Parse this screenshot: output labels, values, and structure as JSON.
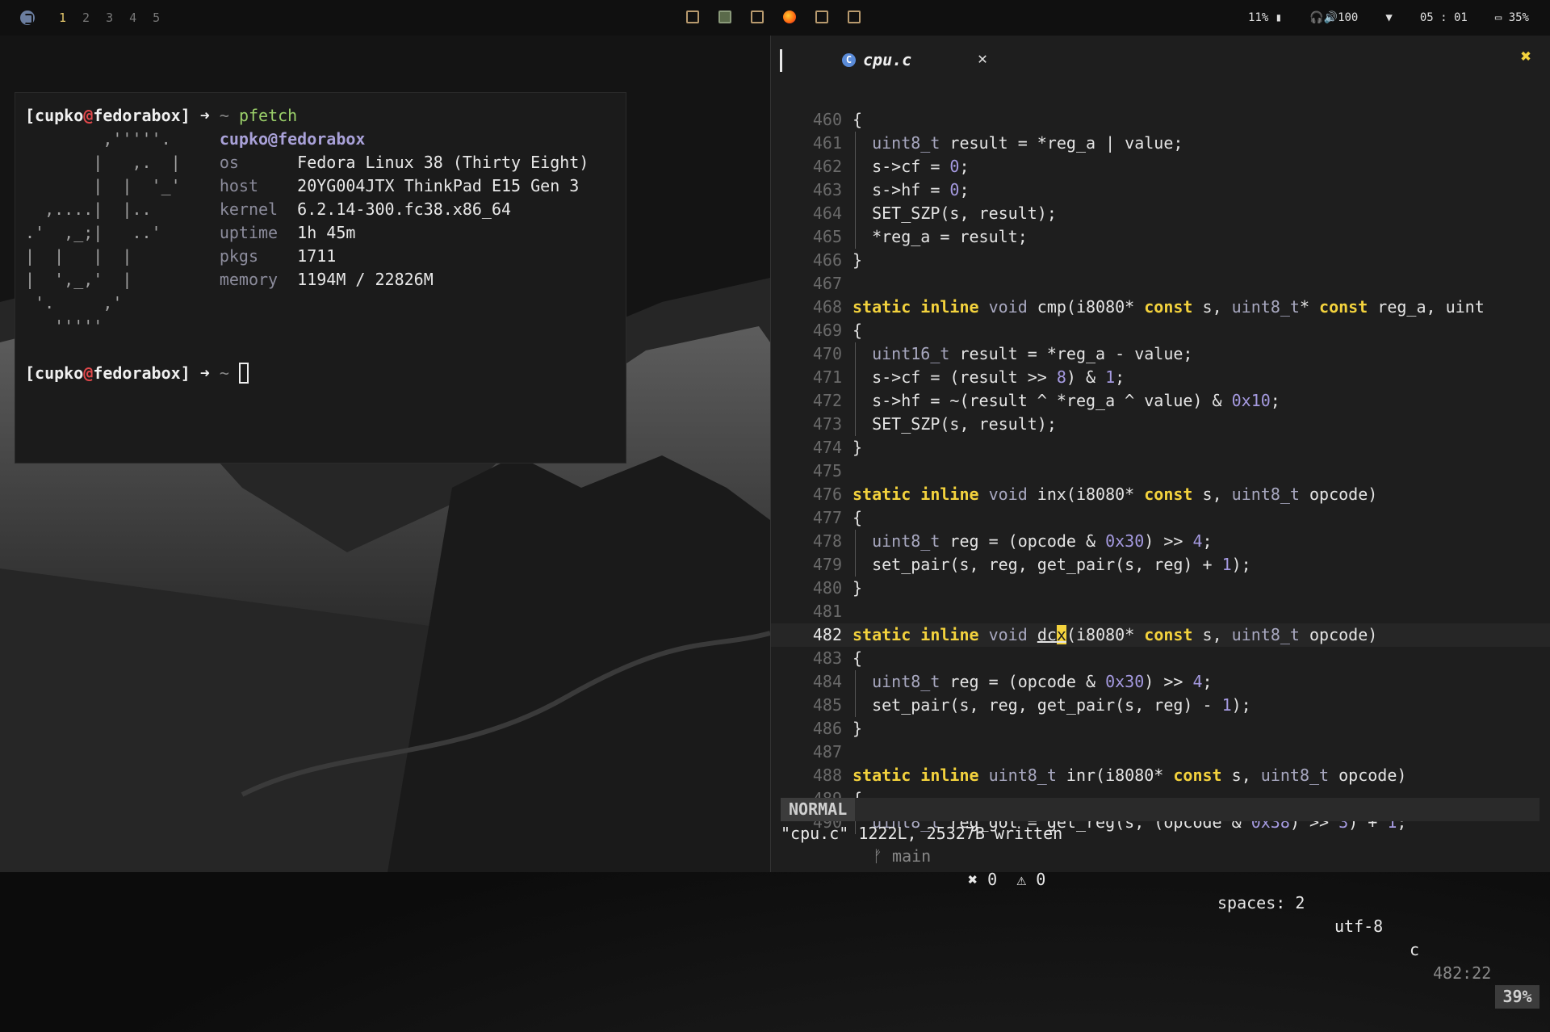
{
  "topbar": {
    "workspaces": [
      "1",
      "2",
      "3",
      "4",
      "5"
    ],
    "active_workspace": "1",
    "tray_icons": [
      "app-icon",
      "image-viewer-icon",
      "app-icon",
      "firefox-icon",
      "app-icon",
      "app-icon"
    ],
    "cpu": "11%",
    "volume": "100",
    "clock": "05 : 01",
    "battery": "35%"
  },
  "terminal": {
    "user": "cupko",
    "host": "fedorabox",
    "command": "pfetch",
    "fetch_title": "cupko@fedorabox",
    "ascii_art": [
      "        ,'''''.  ",
      "       |   ,.  | ",
      "       |  |  '_' ",
      "  ,....|  |..    ",
      ".'  ,_;|   ..'   ",
      "|  |   |  |      ",
      "|  ',_,'  |      ",
      " '.     ,'       ",
      "   '''''         "
    ],
    "info": [
      {
        "key": "os",
        "val": "Fedora Linux 38 (Thirty Eight)"
      },
      {
        "key": "host",
        "val": "20YG004JTX ThinkPad E15 Gen 3"
      },
      {
        "key": "kernel",
        "val": "6.2.14-300.fc38.x86_64"
      },
      {
        "key": "uptime",
        "val": "1h 45m"
      },
      {
        "key": "pkgs",
        "val": "1711"
      },
      {
        "key": "memory",
        "val": "1194M / 22826M"
      }
    ]
  },
  "editor": {
    "tab_title": "cpu.c",
    "tab_icon": "C",
    "close_glyph": "✕",
    "window_close_glyph": "✖",
    "code_lines": [
      {
        "n": "460",
        "t": "{"
      },
      {
        "n": "461",
        "t": "  uint8_t result = *reg_a | value;"
      },
      {
        "n": "462",
        "t": "  s->cf = 0;"
      },
      {
        "n": "463",
        "t": "  s->hf = 0;"
      },
      {
        "n": "464",
        "t": "  SET_SZP(s, result);"
      },
      {
        "n": "465",
        "t": "  *reg_a = result;"
      },
      {
        "n": "466",
        "t": "}"
      },
      {
        "n": "467",
        "t": ""
      },
      {
        "n": "468",
        "t": "static inline void cmp(i8080* const s, uint8_t* const reg_a, uint"
      },
      {
        "n": "469",
        "t": "{"
      },
      {
        "n": "470",
        "t": "  uint16_t result = *reg_a - value;"
      },
      {
        "n": "471",
        "t": "  s->cf = (result >> 8) & 1;"
      },
      {
        "n": "472",
        "t": "  s->hf = ~(result ^ *reg_a ^ value) & 0x10;"
      },
      {
        "n": "473",
        "t": "  SET_SZP(s, result);"
      },
      {
        "n": "474",
        "t": "}"
      },
      {
        "n": "475",
        "t": ""
      },
      {
        "n": "476",
        "t": "static inline void inx(i8080* const s, uint8_t opcode)"
      },
      {
        "n": "477",
        "t": "{"
      },
      {
        "n": "478",
        "t": "  uint8_t reg = (opcode & 0x30) >> 4;"
      },
      {
        "n": "479",
        "t": "  set_pair(s, reg, get_pair(s, reg) + 1);"
      },
      {
        "n": "480",
        "t": "}"
      },
      {
        "n": "481",
        "t": ""
      },
      {
        "n": "482",
        "t": "static inline void dcx(i8080* const s, uint8_t opcode)"
      },
      {
        "n": "483",
        "t": "{"
      },
      {
        "n": "484",
        "t": "  uint8_t reg = (opcode & 0x30) >> 4;"
      },
      {
        "n": "485",
        "t": "  set_pair(s, reg, get_pair(s, reg) - 1);"
      },
      {
        "n": "486",
        "t": "}"
      },
      {
        "n": "487",
        "t": ""
      },
      {
        "n": "488",
        "t": "static inline uint8_t inr(i8080* const s, uint8_t opcode)"
      },
      {
        "n": "489",
        "t": "{"
      },
      {
        "n": "490",
        "t": "  uint8_t reg_got = get_reg(s, (opcode & 0x38) >> 3) + 1;"
      }
    ],
    "current_line": "482",
    "status": {
      "mode": "NORMAL",
      "branch": "ᚠ main",
      "diagnostics": "✖ 0  ⚠ 0",
      "spaces": "spaces: 2",
      "encoding": "utf-8",
      "filetype": "c",
      "position": "482:22",
      "percent": "39%"
    },
    "command_line": "\"cpu.c\" 1222L, 25327B written"
  },
  "colors": {
    "keyword": "#f3d23d",
    "type": "#a8a8c0",
    "number": "#a59ae0",
    "prompt_at": "#e0484b",
    "command": "#9bd06a"
  }
}
